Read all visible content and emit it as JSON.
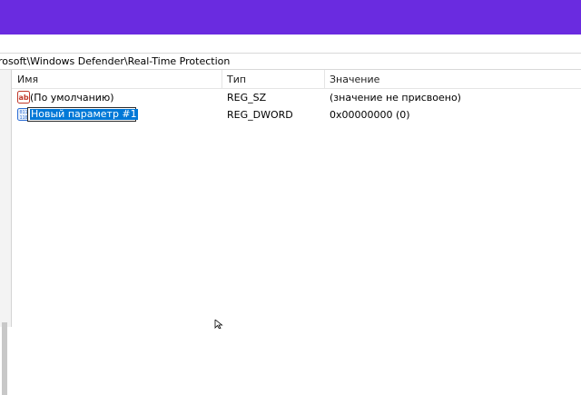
{
  "address": {
    "path": "rosoft\\Windows Defender\\Real-Time Protection"
  },
  "columns": {
    "name": "Имя",
    "type": "Тип",
    "value": "Значение"
  },
  "rows": [
    {
      "icon": "string-value-icon",
      "name": "(По умолчанию)",
      "type": "REG_SZ",
      "value": "(значение не присвоено)"
    },
    {
      "icon": "dword-value-icon",
      "name": "Новый параметр #1",
      "type": "REG_DWORD",
      "value": "0x00000000 (0)",
      "editing": true
    }
  ],
  "colors": {
    "title_bar": "#6a2be0",
    "selection": "#0078d7"
  }
}
